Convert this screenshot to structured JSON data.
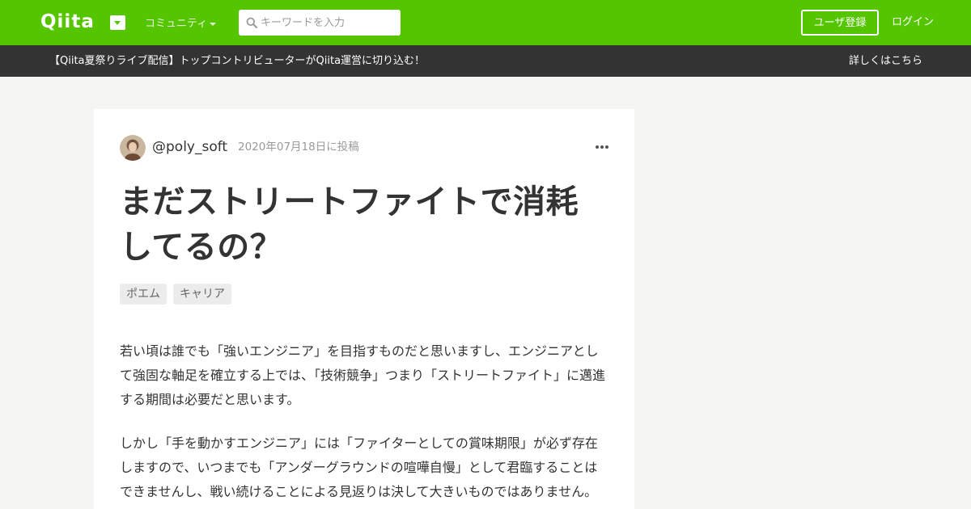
{
  "nav": {
    "logo": "Qiita",
    "community_label": "コミュニティ",
    "search_placeholder": "キーワードを入力",
    "signup_label": "ユーザ登録",
    "login_label": "ログイン",
    "brand_color": "#55c500"
  },
  "announcement": {
    "text": "【Qiita夏祭りライブ配信】トップコントリビューターがQiita運営に切り込む！",
    "link_label": "詳しくはこちら"
  },
  "article": {
    "author": "@poly_soft",
    "posted": "2020年07月18日に投稿",
    "title_line1": "まだストリートファイトで消耗",
    "title_line2": "してるの？",
    "tags": [
      "ポエム",
      "キャリア"
    ],
    "paragraphs": [
      "若い頃は誰でも「強いエンジニア」を目指すものだと思いますし、エンジニアとして強固な軸足を確立する上では、「技術競争」つまり「ストリートファイト」に邁進する期間は必要だと思います。",
      "しかし「手を動かすエンジニア」には「ファイターとしての賞味期限」が必ず存在しますので、いつまでも「アンダーグラウンドの喧嘩自慢」として君臨することはできませんし、戦い続けることによる見返りは決して大きいものではありません。"
    ]
  },
  "icons": {
    "logo_dropdown": "caret-down-icon",
    "search": "search-icon",
    "more": "more-horizontal-icon",
    "avatar": "avatar"
  }
}
